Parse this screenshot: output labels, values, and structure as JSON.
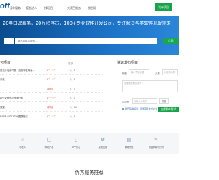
{
  "header": {
    "logo": "oft",
    "nav": [
      "接单服务",
      "接包达人",
      "找项目",
      "大项目服务",
      "独权网"
    ],
    "post_button": "发布项目"
  },
  "banner": {
    "title": "20年口碑服务，20万程序员，100+专业软件开发公司，专注解决各类软件开发需求",
    "search_placeholder": "输入关键词搜索...",
    "search_button": "立即"
  },
  "projects": {
    "title": "包项目",
    "more": "更多",
    "items": [
      {
        "title": "微信小程序开发（包括平板端及...",
        "price": "1千~5千",
        "count": "2、1"
      },
      {
        "title": "系统",
        "price": "1千~5千",
        "count": "2、1"
      },
      {
        "title": "",
        "price": "待商议",
        "count": "2、7"
      },
      {
        "title": "APP及微信小程序开发",
        "price": "1千~5千",
        "count": "2、3"
      },
      {
        "title": "微整",
        "price": "待商议",
        "count": "2、16"
      },
      {
        "title": "ECOS+CRYSTAL图像接试",
        "price": "1千~5千",
        "count": "2、1"
      }
    ]
  },
  "quick_post": {
    "title": "快速发布项目",
    "title_label": "标题",
    "title_placeholder": "输入项目标题",
    "type_label": "分类",
    "type_placeholder": "请选择分类",
    "desc_placeholder": "简要描述项目需求...",
    "phone_label": "手机号",
    "phone_placeholder": "请输入手机号",
    "code_button": "获取",
    "agree_text": "我已阅读并同意《软件项目发布协议》",
    "submit_button": "立即发布需求"
  },
  "categories": [
    {
      "icon": "hand-icon",
      "glyph": "☝",
      "label": "小程序"
    },
    {
      "icon": "web-icon",
      "glyph": "▢",
      "label": "网站开发"
    },
    {
      "icon": "app-icon",
      "glyph": "▯",
      "label": "APP开发"
    },
    {
      "icon": "gear-icon",
      "glyph": "⚙",
      "label": "桌面应用"
    },
    {
      "icon": "chart-icon",
      "glyph": "▤",
      "label": "管理系统"
    },
    {
      "icon": "tool-icon",
      "glyph": "✎",
      "label": "数据采集与分析"
    }
  ],
  "section_title": "优秀服务推荐"
}
